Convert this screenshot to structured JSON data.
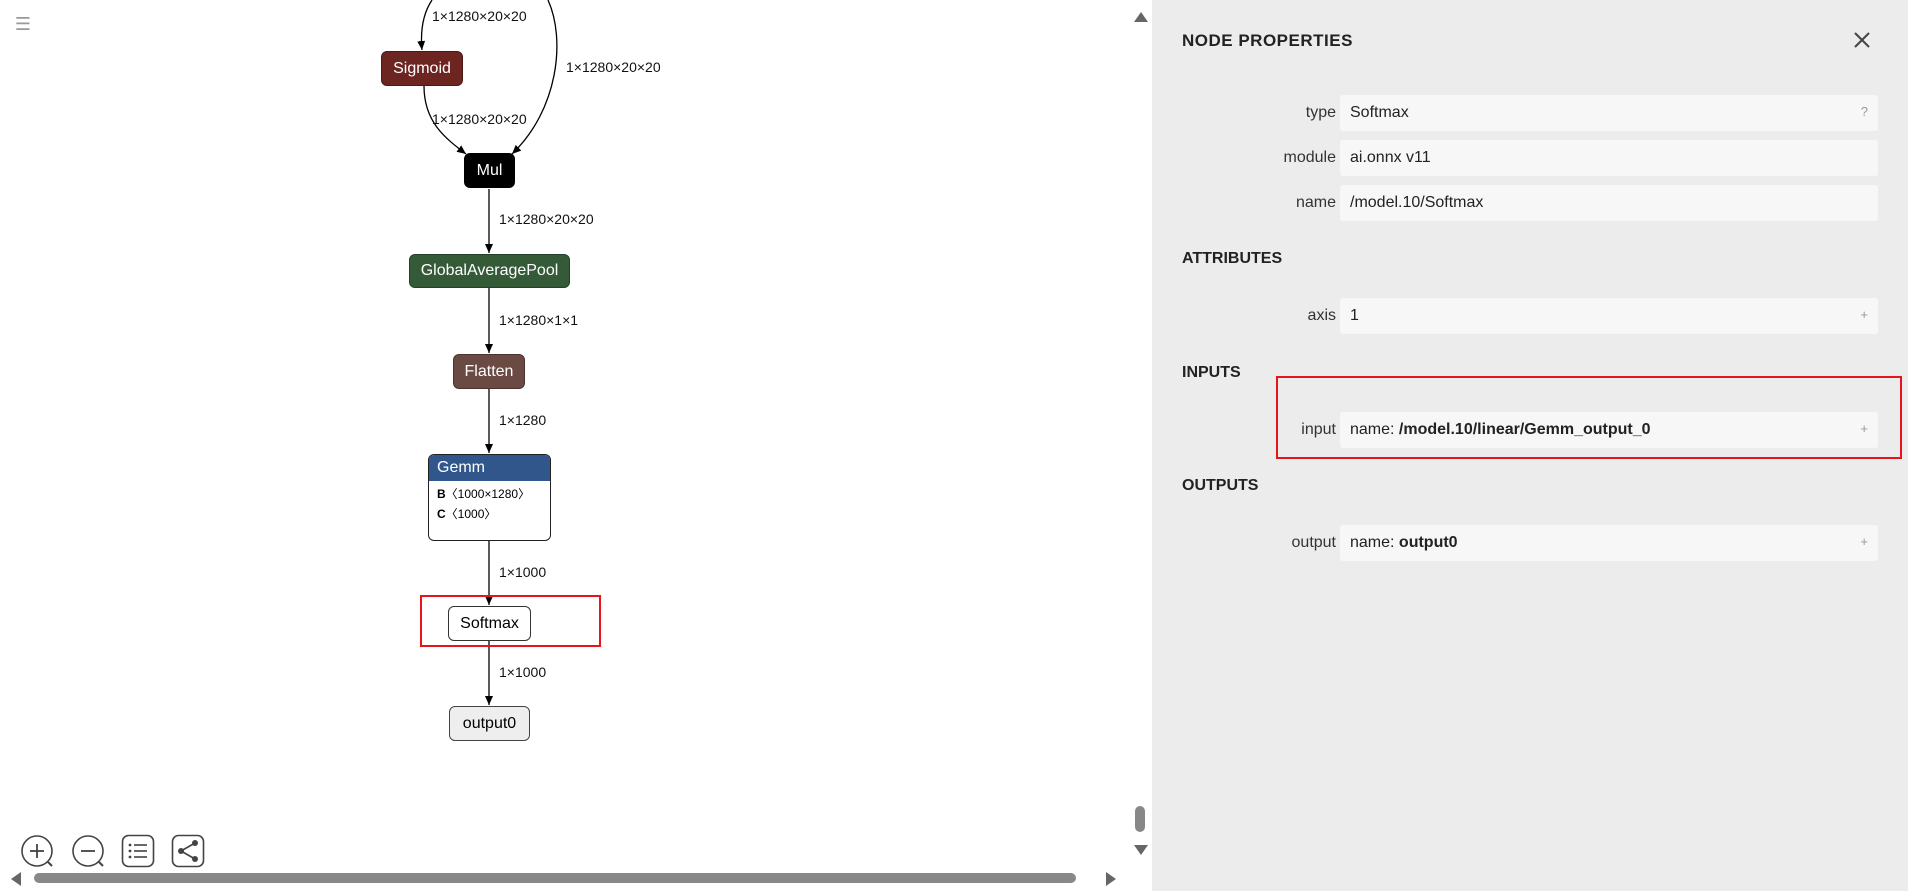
{
  "canvas": {
    "menu_icon": "hamburger-icon",
    "nodes": {
      "sigmoid": "Sigmoid",
      "mul": "Mul",
      "gap": "GlobalAveragePool",
      "flatten": "Flatten",
      "gemm": {
        "title": "Gemm",
        "attrs": [
          {
            "name": "B",
            "value": "〈1000×1280〉"
          },
          {
            "name": "C",
            "value": "〈1000〉"
          }
        ]
      },
      "softmax": "Softmax",
      "output": "output0"
    },
    "edges": {
      "top_in": "1×1280×20×20",
      "bypass": "1×1280×20×20",
      "sigmoid_mul": "1×1280×20×20",
      "mul_gap": "1×1280×20×20",
      "gap_flatten": "1×1280×1×1",
      "flatten_gemm": "1×1280",
      "gemm_softmax": "1×1000",
      "softmax_output": "1×1000"
    },
    "toolbar": {
      "zoom_in_icon": "zoom-in-icon",
      "zoom_out_icon": "zoom-out-icon",
      "list_icon": "list-icon",
      "share_icon": "share-icon"
    },
    "colors": {
      "sigmoid": "#6d2521",
      "mul": "#000000",
      "gap": "#355a38",
      "flatten": "#6a4a42",
      "gemm": "#30568c",
      "highlight": "#e8141c"
    }
  },
  "panel": {
    "title": "NODE PROPERTIES",
    "close_icon": "close-icon",
    "properties": [
      {
        "label": "type",
        "value": "Softmax",
        "side": "?"
      },
      {
        "label": "module",
        "value": "ai.onnx v11"
      },
      {
        "label": "name",
        "value": "/model.10/Softmax"
      }
    ],
    "attributes_title": "ATTRIBUTES",
    "attributes": [
      {
        "label": "axis",
        "value": "1",
        "side": "+"
      }
    ],
    "inputs_title": "INPUTS",
    "inputs": [
      {
        "label": "input",
        "prefix": "name: ",
        "value": "/model.10/linear/Gemm_output_0",
        "side": "+"
      }
    ],
    "outputs_title": "OUTPUTS",
    "outputs": [
      {
        "label": "output",
        "prefix": "name: ",
        "value": "output0",
        "side": "+"
      }
    ]
  }
}
